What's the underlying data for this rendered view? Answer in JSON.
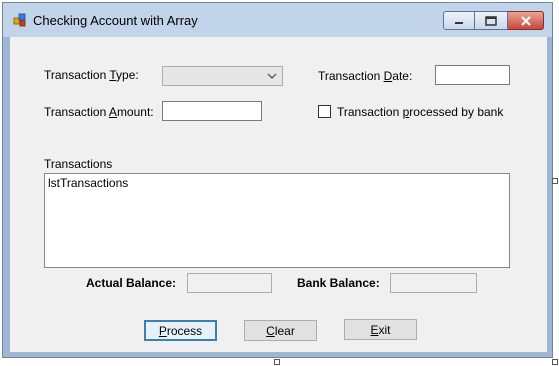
{
  "window": {
    "title": "Checking Account with Array",
    "icon": "winforms-app-icon"
  },
  "form": {
    "transaction_type": {
      "pre": "Transaction ",
      "accel": "T",
      "post": "ype:",
      "selected_value": ""
    },
    "transaction_date": {
      "pre": "Transaction ",
      "accel": "D",
      "post": "ate:",
      "value": ""
    },
    "transaction_amount": {
      "pre": "Transaction ",
      "accel": "A",
      "post": "mount:",
      "value": ""
    },
    "processed_by_bank": {
      "pre": "Transaction ",
      "accel": "p",
      "post": "rocessed by bank",
      "checked": false
    },
    "transactions": {
      "label": "Transactions",
      "items": [
        "lstTransactions"
      ]
    },
    "actual_balance": {
      "label": "Actual Balance:",
      "value": ""
    },
    "bank_balance": {
      "label": "Bank Balance:",
      "value": ""
    }
  },
  "buttons": {
    "process": {
      "accel": "P",
      "rest": "rocess"
    },
    "clear": {
      "accel": "C",
      "rest": "lear"
    },
    "exit": {
      "accel": "E",
      "rest": "xit"
    }
  }
}
